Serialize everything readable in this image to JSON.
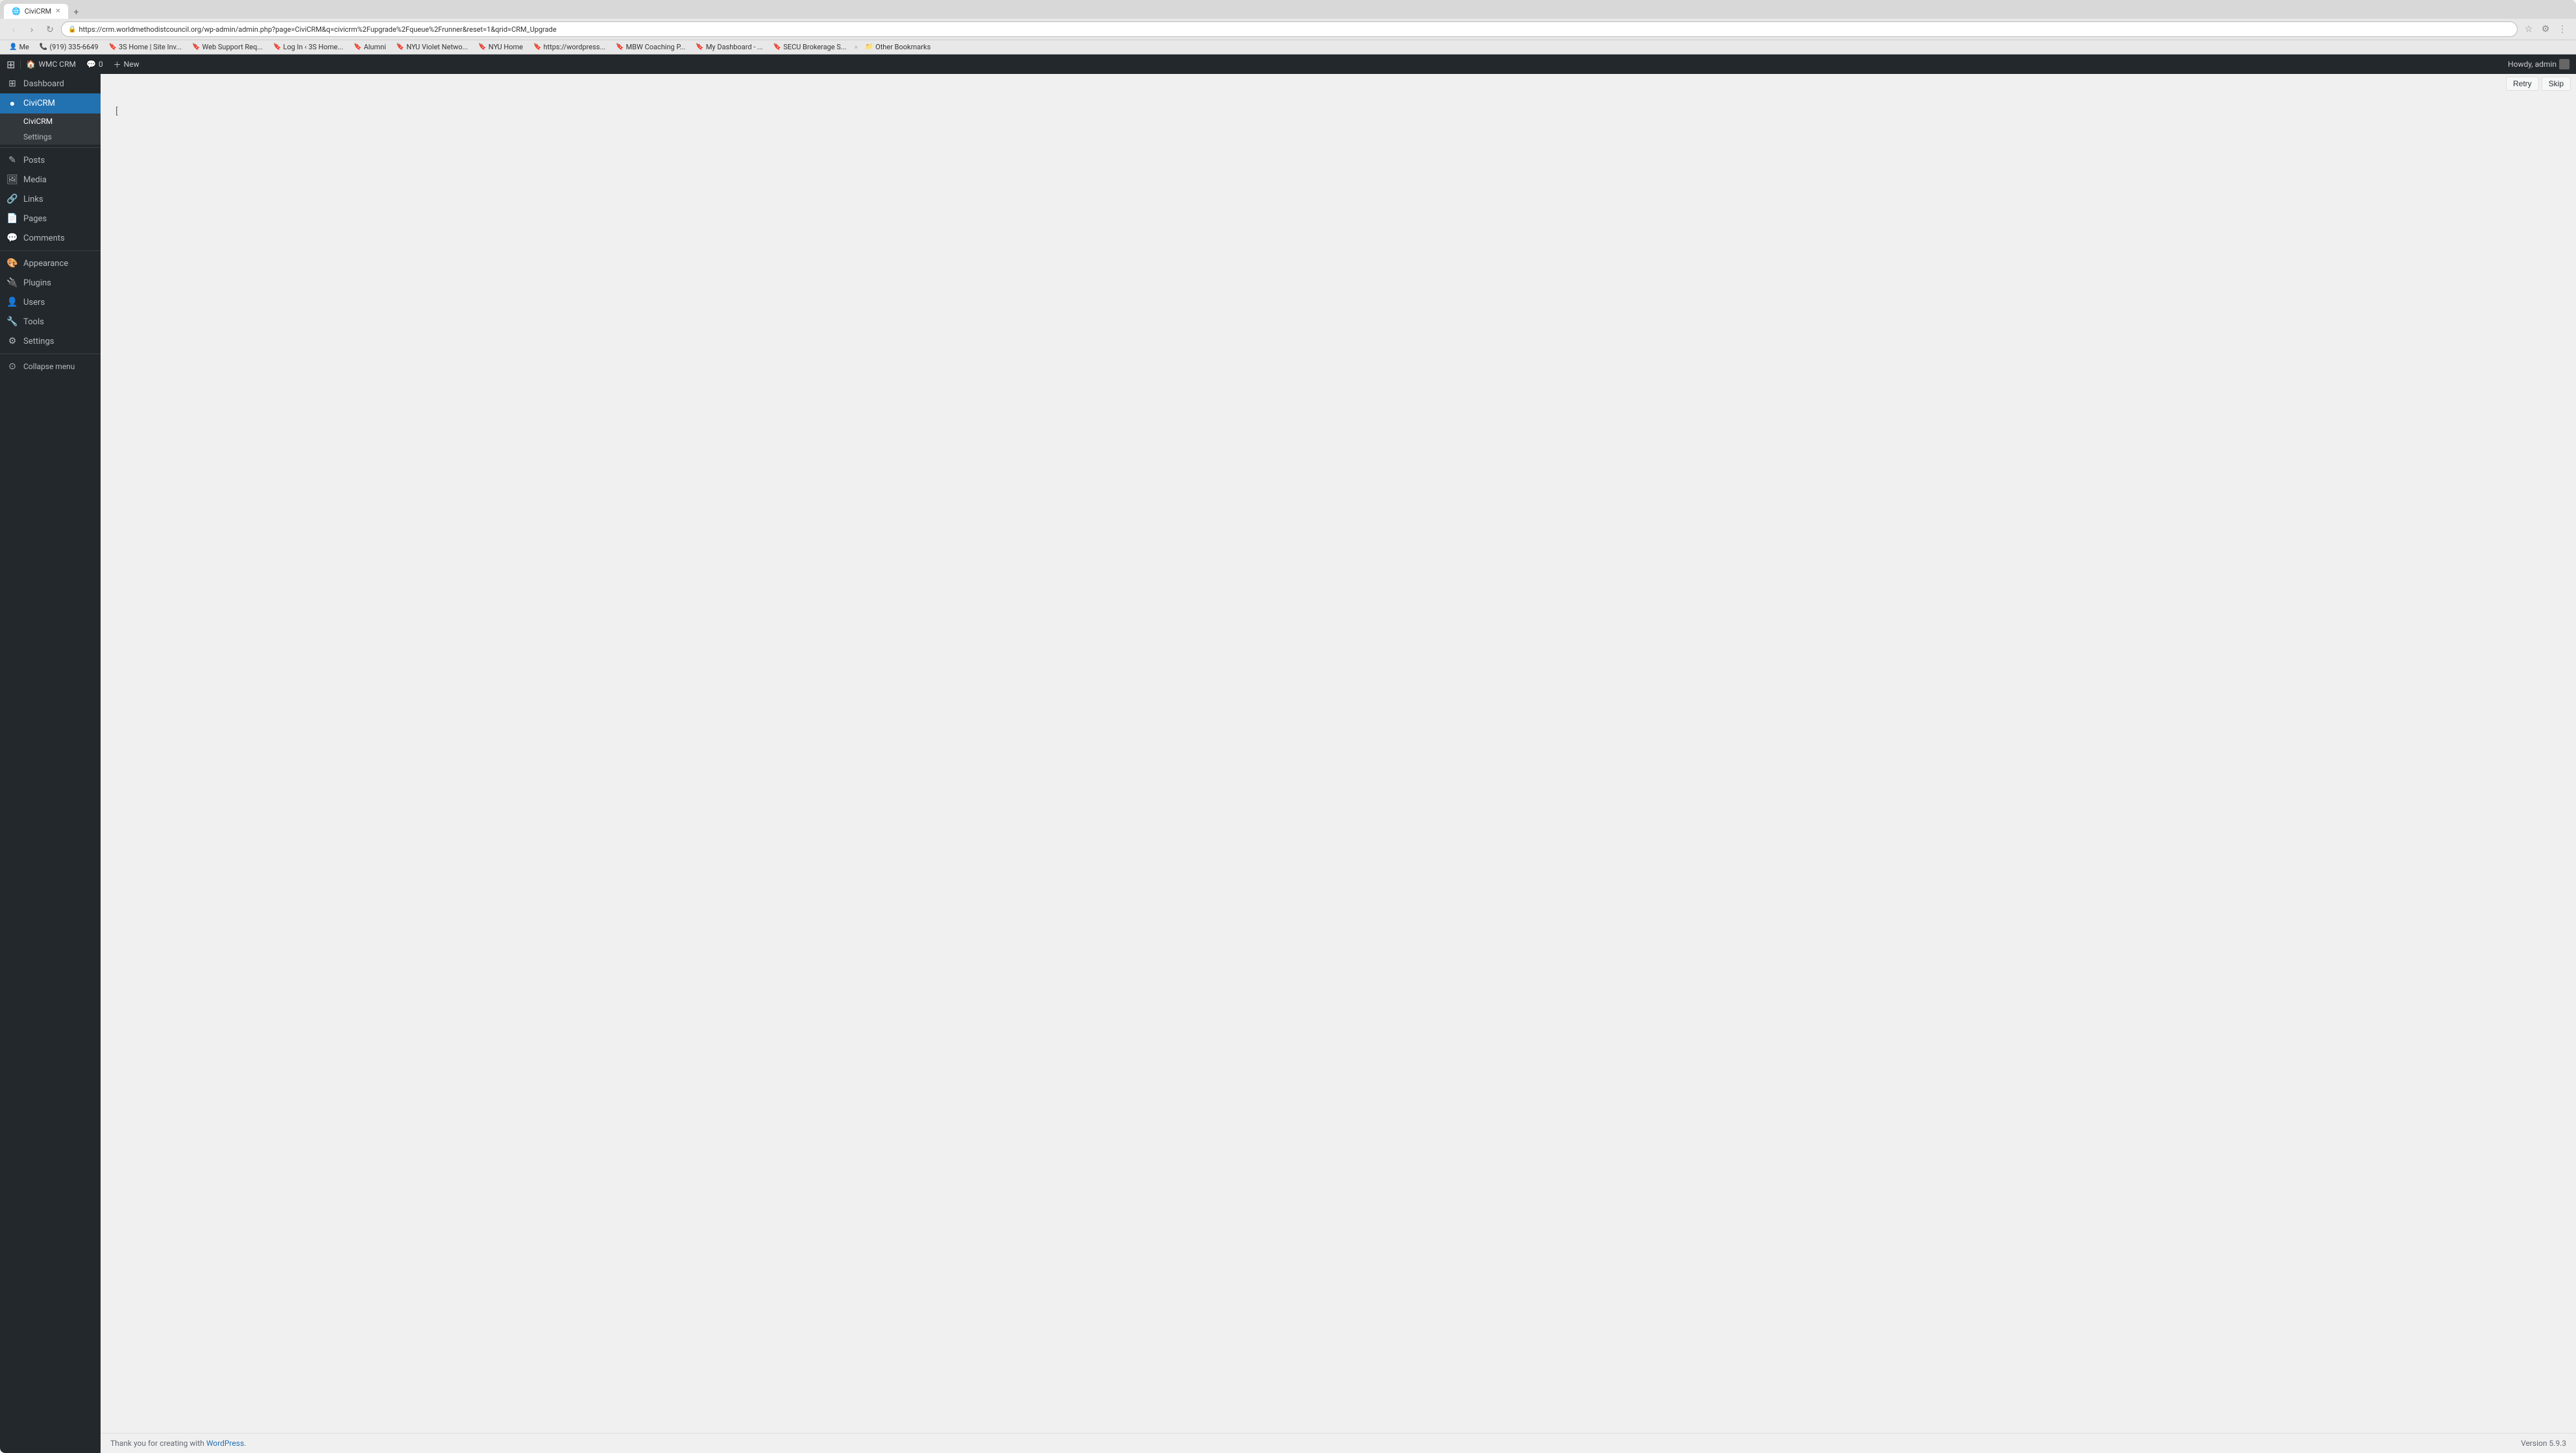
{
  "browser": {
    "tab_title": "CiviCRM",
    "url": "https://crm.worldmethodistcouncil.org/wp-admin/admin.php?page=CiviCRM&q=civicrm%2Fupgrade%2Fqueue%2Frunner&reset=1&qrid=CRM_Upgrade",
    "favicon": "🌐"
  },
  "bookmarks": [
    {
      "label": "Me",
      "icon": "👤"
    },
    {
      "label": "(919) 335-6649",
      "icon": "📞"
    },
    {
      "label": "3S Home | Site Inv...",
      "icon": "🔖"
    },
    {
      "label": "Web Support Req...",
      "icon": "🔖"
    },
    {
      "label": "Log In ‹ 3S Home...",
      "icon": "🔖"
    },
    {
      "label": "Alumni",
      "icon": "🔖"
    },
    {
      "label": "NYU Violet Netwo...",
      "icon": "🔖"
    },
    {
      "label": "NYU Home",
      "icon": "🔖"
    },
    {
      "label": "https://wordpress...",
      "icon": "🔖"
    },
    {
      "label": "MBW Coaching P...",
      "icon": "🔖"
    },
    {
      "label": "My Dashboard - ...",
      "icon": "🔖"
    },
    {
      "label": "SECU Brokerage S...",
      "icon": "🔖"
    },
    {
      "label": "Other Bookmarks",
      "icon": "📁"
    }
  ],
  "wp_admin_bar": {
    "site_name": "WMC CRM",
    "comments_count": "0",
    "new_label": "New",
    "howdy": "Howdy, admin"
  },
  "sidebar": {
    "dashboard_label": "Dashboard",
    "civicrm_label": "CiviCRM",
    "civicrm_sub": {
      "civicrm": "CiviCRM",
      "settings": "Settings"
    },
    "posts_label": "Posts",
    "media_label": "Media",
    "links_label": "Links",
    "pages_label": "Pages",
    "comments_label": "Comments",
    "appearance_label": "Appearance",
    "plugins_label": "Plugins",
    "users_label": "Users",
    "tools_label": "Tools",
    "settings_label": "Settings",
    "collapse_label": "Collapse menu"
  },
  "content": {
    "retry_label": "Retry",
    "skip_label": "Skip",
    "loading_char": "["
  },
  "footer": {
    "thank_you_text": "Thank you for creating with ",
    "wordpress_link": "WordPress",
    "version": "Version 5.9.3"
  }
}
